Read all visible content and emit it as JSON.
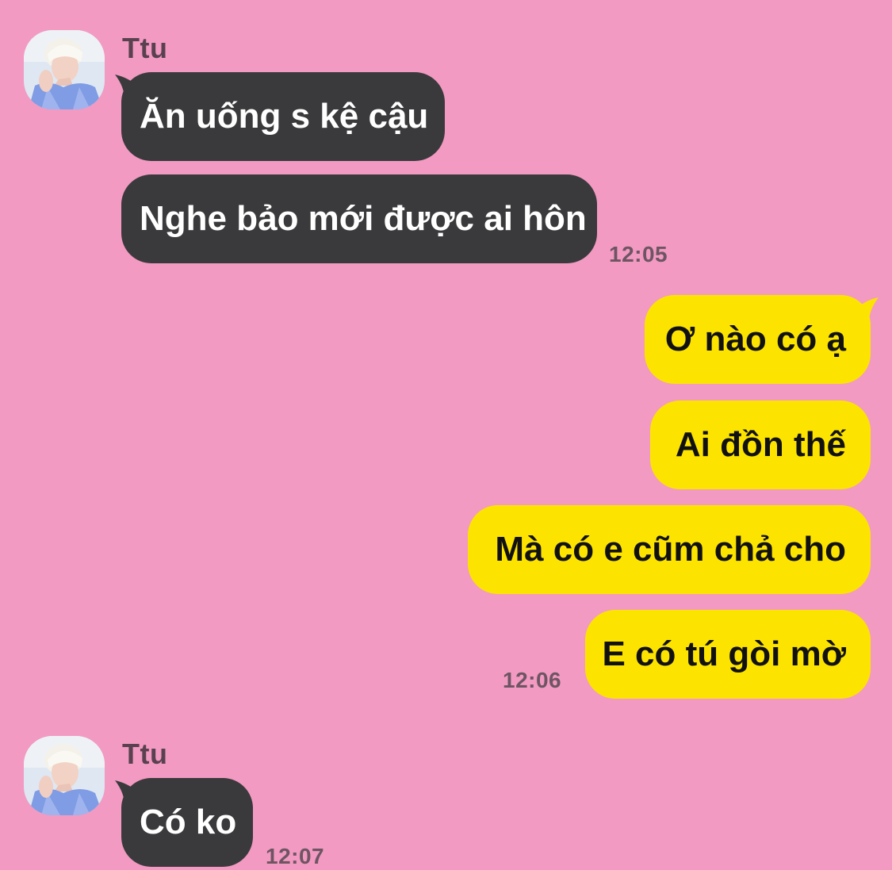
{
  "colors": {
    "background": "#f29ac2",
    "incoming_bubble": "#3a3a3c",
    "outgoing_bubble": "#fde400",
    "incoming_text": "#ffffff",
    "outgoing_text": "#111111",
    "meta_text": "#6e5563"
  },
  "groups": [
    {
      "direction": "incoming",
      "sender": "Ttu",
      "avatar_icon": "profile-photo-avatar",
      "messages": [
        {
          "text": "Ăn uống s kệ cậu"
        },
        {
          "text": "Nghe bảo mới được ai hôn"
        }
      ],
      "time": "12:05"
    },
    {
      "direction": "outgoing",
      "messages": [
        {
          "text": "Ơ nào có ạ"
        },
        {
          "text": "Ai đồn thế"
        },
        {
          "text": "Mà có e cũm chả cho"
        },
        {
          "text": "E có tú gòi mờ"
        }
      ],
      "time": "12:06"
    },
    {
      "direction": "incoming",
      "sender": "Ttu",
      "avatar_icon": "profile-photo-avatar",
      "messages": [
        {
          "text": "Có ko"
        }
      ],
      "time": "12:07"
    }
  ]
}
